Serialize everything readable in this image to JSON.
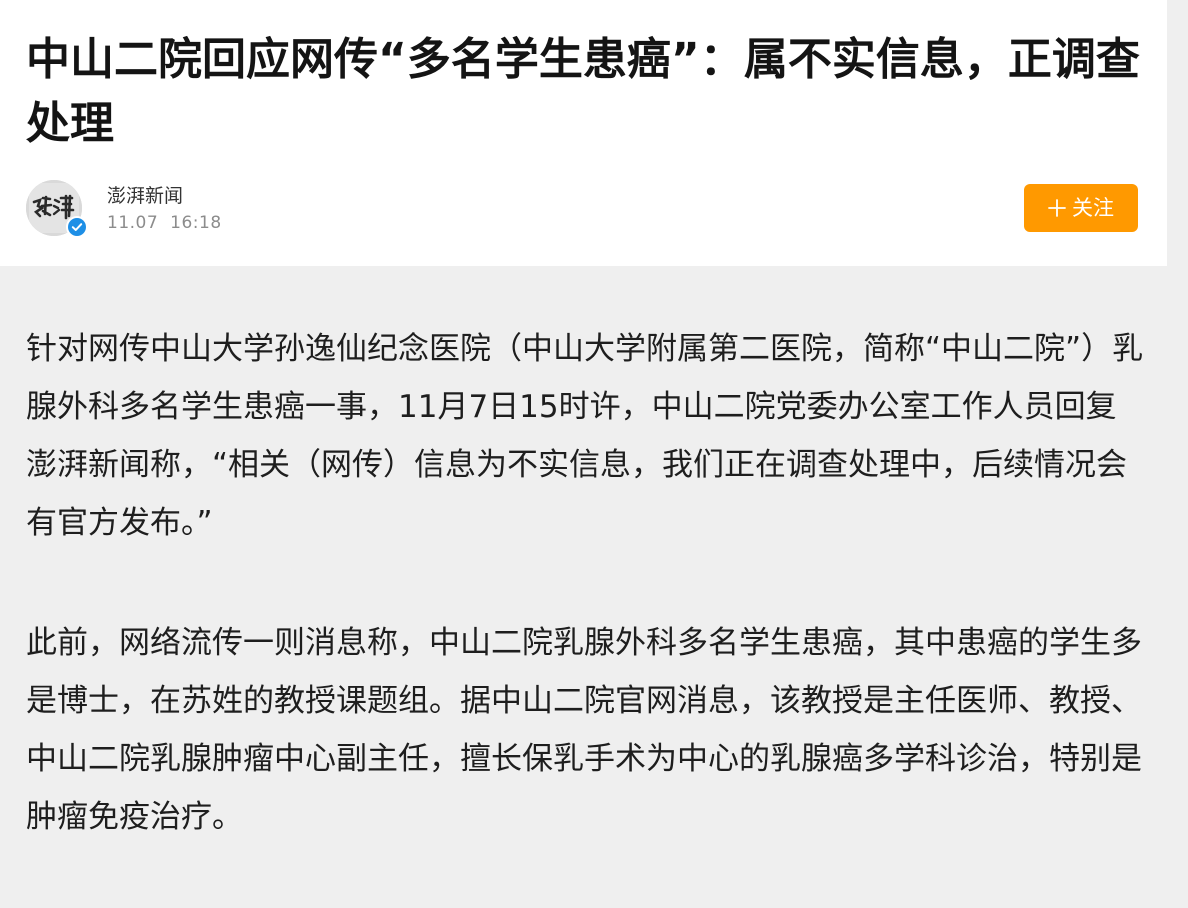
{
  "article": {
    "title": "中山二院回应网传“多名学生患癌”：属不实信息，正调查处理",
    "author": {
      "name": "澎湃新闻",
      "avatar_icon": "pengpai-logo-icon",
      "verified_icon": "verified-check-icon"
    },
    "date": "11.07",
    "time": "16:18",
    "follow_label": "关注",
    "follow_icon": "plus-icon",
    "paragraphs": [
      "针对网传中山大学孙逸仙纪念医院（中山大学附属第二医院，简称“中山二院”）乳腺外科多名学生患癌一事，11月7日15时许，中山二院党委办公室工作人员回复澎湃新闻称，“相关（网传）信息为不实信息，我们正在调查处理中，后续情况会有官方发布。”",
      "此前，网络流传一则消息称，中山二院乳腺外科多名学生患癌，其中患癌的学生多是博士，在苏姓的教授课题组。据中山二院官网消息，该教授是主任医师、教授、中山二院乳腺肿瘤中心副主任，擅长保乳手术为中心的乳腺癌多学科诊治，特别是肿瘤免疫治疗。"
    ]
  },
  "colors": {
    "accent": "#ff9900",
    "verified": "#1e8fe6",
    "page_background": "#efefef"
  }
}
